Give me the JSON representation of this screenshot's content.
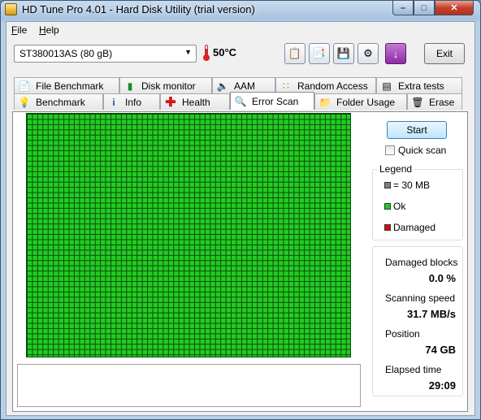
{
  "window": {
    "title": "HD Tune Pro 4.01 - Hard Disk Utility (trial version)",
    "controls": {
      "minimize": "–",
      "maximize": "□",
      "close": "✕"
    }
  },
  "menu": {
    "file": "File",
    "help": "Help"
  },
  "toolbar": {
    "drive": "ST380013AS (80 gB)",
    "temperature": "50°C",
    "buttons": [
      "copy-info-icon",
      "copy-screen-icon",
      "save-icon",
      "options-icon",
      "download-icon"
    ],
    "exit_label": "Exit"
  },
  "tabs": {
    "row1": [
      {
        "label": "File Benchmark",
        "icon": "file-benchmark-icon"
      },
      {
        "label": "Disk monitor",
        "icon": "disk-monitor-icon"
      },
      {
        "label": "AAM",
        "icon": "speaker-icon"
      },
      {
        "label": "Random Access",
        "icon": "random-access-icon"
      },
      {
        "label": "Extra tests",
        "icon": "extra-tests-icon"
      }
    ],
    "row2": [
      {
        "label": "Benchmark",
        "icon": "lightbulb-icon"
      },
      {
        "label": "Info",
        "icon": "info-icon"
      },
      {
        "label": "Health",
        "icon": "health-cross-icon"
      },
      {
        "label": "Error Scan",
        "icon": "magnifier-icon",
        "active": true
      },
      {
        "label": "Folder Usage",
        "icon": "folder-icon"
      },
      {
        "label": "Erase",
        "icon": "trash-icon"
      }
    ]
  },
  "error_scan": {
    "block_status": "all ok",
    "start_label": "Start",
    "quick_scan_label": "Quick scan",
    "quick_scan_checked": false,
    "legend": {
      "title": "Legend",
      "block_size": "= 30 MB",
      "ok": "Ok",
      "damaged": "Damaged",
      "colors": {
        "block": "#808080",
        "ok": "#22cc22",
        "damaged": "#cc1111"
      }
    },
    "stats": {
      "damaged_blocks_label": "Damaged blocks",
      "damaged_blocks_value": "0.0 %",
      "scanning_speed_label": "Scanning speed",
      "scanning_speed_value": "31.7 MB/s",
      "position_label": "Position",
      "position_value": "74 GB",
      "elapsed_label": "Elapsed time",
      "elapsed_value": "29:09"
    }
  }
}
